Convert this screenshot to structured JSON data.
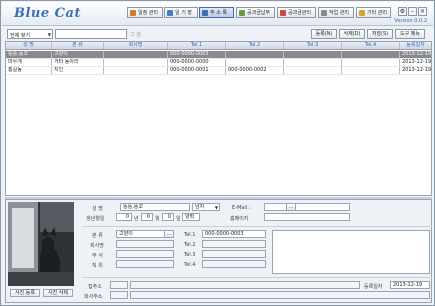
{
  "app": {
    "title": "Blue Cat",
    "version": "Version 0.0.2"
  },
  "toolbar": {
    "buttons": [
      {
        "label": "일정 관리",
        "icon": "calendar-icon",
        "active": false
      },
      {
        "label": "일 기 장",
        "icon": "diary-icon",
        "active": false
      },
      {
        "label": "주 소 록",
        "icon": "addressbook-icon",
        "active": true
      },
      {
        "label": "공과금납부",
        "icon": "bill-icon",
        "active": false
      },
      {
        "label": "공과금관리",
        "icon": "coin-icon",
        "active": false
      },
      {
        "label": "작업 관리",
        "icon": "task-icon",
        "active": false
      },
      {
        "label": "기타 관리",
        "icon": "etc-icon",
        "active": false
      }
    ]
  },
  "search": {
    "scope_value": "전체 찾기",
    "query_value": "",
    "query_suffix": "그 검",
    "add_label": "등록(N)",
    "delete_label": "삭제(D)",
    "save_label": "저장(S)",
    "tools_label": "도구 메뉴"
  },
  "table": {
    "columns": [
      "성 명",
      "분 류",
      "회사명",
      "Tel.1",
      "Tel.2",
      "Tel.3",
      "Tel.4",
      "등록일자"
    ],
    "rows": [
      {
        "name": "뚱뚱,뚱꼬",
        "category": "고양이",
        "company": "",
        "tel1": "000-0000-0003",
        "tel2": "",
        "tel3": "",
        "tel4": "",
        "date": "2013-12-19",
        "selected": true
      },
      {
        "name": "마우개",
        "category": "거타 동아리",
        "company": "",
        "tel1": "000-0000-0000",
        "tel2": "",
        "tel3": "",
        "tel4": "",
        "date": "2013-12-19",
        "selected": false
      },
      {
        "name": "홍길동",
        "category": "지인",
        "company": "",
        "tel1": "000-0000-0001",
        "tel2": "000-0000-0002",
        "tel3": "",
        "tel4": "",
        "date": "2013-12-19",
        "selected": false
      }
    ]
  },
  "detail": {
    "name_label": "성 명",
    "name_value": "뚱뚱,뚱꼬",
    "gender_value": "남자",
    "email_label": "E-Mail :",
    "email_value": "",
    "birth_label": "생년월일",
    "birth_year": "0",
    "birth_year_unit": "년",
    "birth_month": "0",
    "birth_month_unit": "월",
    "birth_day": "0",
    "birth_day_unit": "일",
    "calendar_value": "양력",
    "homepage_label": "홈페이지",
    "homepage_value": "",
    "category_label": "분 류",
    "category_value": "고양이",
    "company_label": "회사명",
    "dept_label": "부 서",
    "position_label": "직 위",
    "tel1_label": "Tel.1",
    "tel1_value": "000-0000-0003",
    "tel2_label": "Tel.2",
    "tel3_label": "Tel.3",
    "tel4_label": "Tel.4",
    "home_addr_label": "집주소",
    "company_addr_label": "회사주소",
    "reg_date_label": "등록일자",
    "reg_date_value": "2013-12-19",
    "photo_add_label": "사진 등록",
    "photo_delete_label": "사진 삭제",
    "browse_label": "..."
  }
}
